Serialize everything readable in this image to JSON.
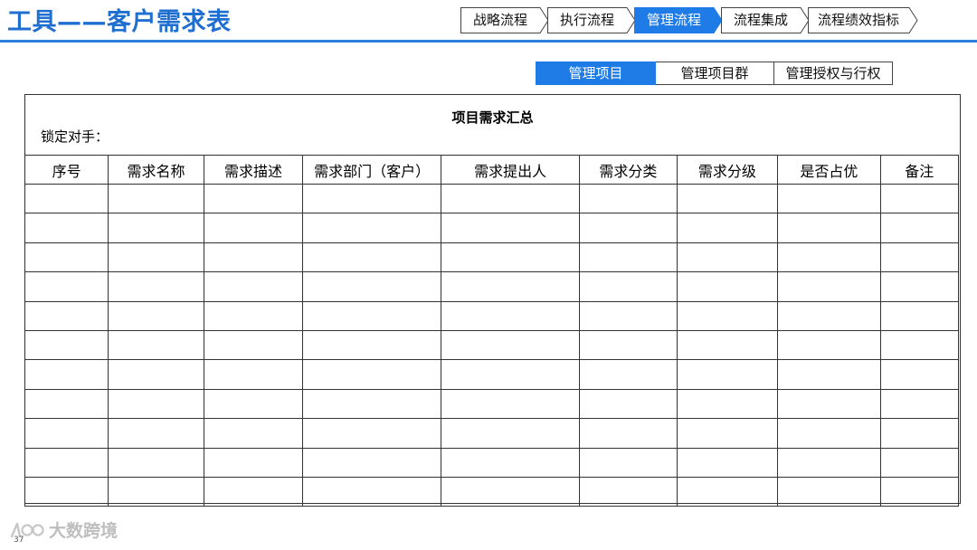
{
  "page": {
    "title": "工具——客户需求表"
  },
  "process_nav": {
    "active_color": "#1f7be5",
    "steps": [
      {
        "label": "战略流程",
        "active": false
      },
      {
        "label": "执行流程",
        "active": false
      },
      {
        "label": "管理流程",
        "active": true
      },
      {
        "label": "流程集成",
        "active": false
      },
      {
        "label": "流程绩效指标",
        "active": false
      }
    ]
  },
  "sub_tabs": [
    {
      "label": "管理项目",
      "active": true
    },
    {
      "label": "管理项目群",
      "active": false
    },
    {
      "label": "管理授权与行权",
      "active": false
    }
  ],
  "form": {
    "title": "项目需求汇总",
    "lock_label": "锁定对手：",
    "columns": [
      "序号",
      "需求名称",
      "需求描述",
      "需求部门（客户）",
      "需求提出人",
      "需求分类",
      "需求分级",
      "是否占优",
      "备注"
    ],
    "empty_rows": 11
  },
  "footer": {
    "watermark": "大数跨境",
    "page_number": "37"
  },
  "colors": {
    "title": "#1f6fd1",
    "rule": "#2e7ee0",
    "accent": "#1f7be5"
  }
}
